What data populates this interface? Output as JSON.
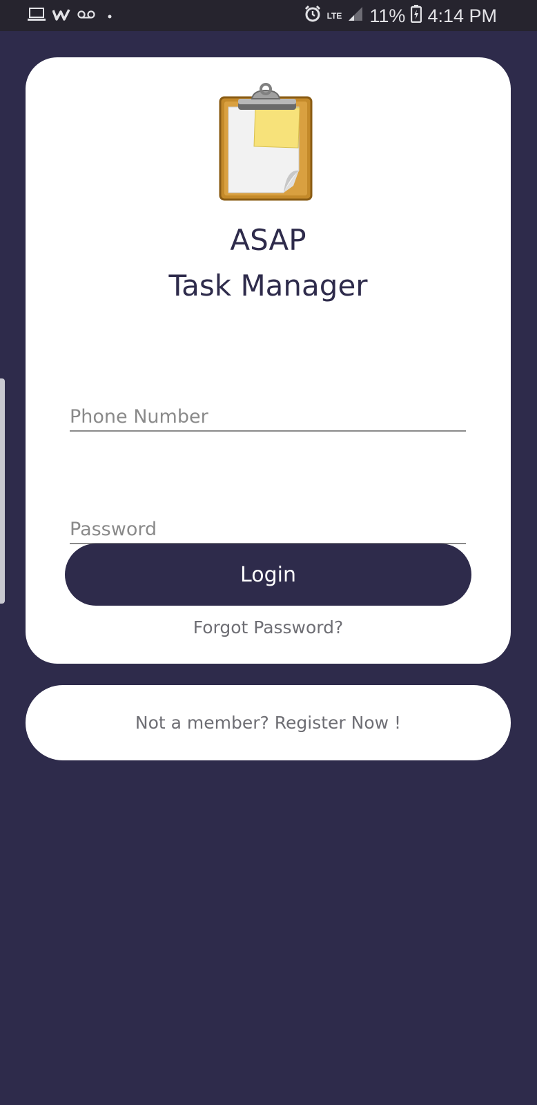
{
  "status_bar": {
    "left_icons": [
      "laptop-icon",
      "w-app-icon",
      "voicemail-icon",
      "dot-icon"
    ],
    "right_icons": [
      "alarm-icon",
      "signal-icon",
      "battery-icon"
    ],
    "network": "LTE",
    "battery_percent": "11%",
    "time": "4:14 PM"
  },
  "app": {
    "logo_icon": "clipboard-icon",
    "title_line1": "ASAP",
    "title_line2": "Task Manager"
  },
  "form": {
    "phone_placeholder": "Phone Number",
    "phone_value": "",
    "password_placeholder": "Password",
    "password_value": "",
    "login_label": "Login",
    "forgot_label": "Forgot Password?"
  },
  "register": {
    "label": "Not a member? Register Now !"
  },
  "colors": {
    "background": "#2e2b4b",
    "card": "#ffffff",
    "primary": "#2e2b4b",
    "muted_text": "#6e6e74"
  }
}
